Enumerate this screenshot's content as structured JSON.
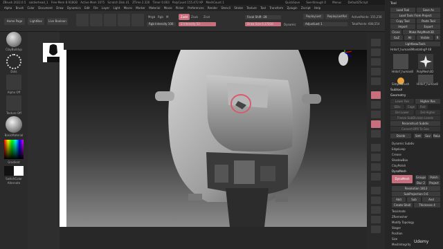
{
  "titlebar": {
    "left": [
      "ZBrush 2022.0.5",
      "soldierhead_1",
      "Free Mem 8.918GB",
      "Active Mem 1075",
      "Scratch Disk 41",
      "ZTime 2.320",
      "Timer 0.003",
      "PolyCount 155.472 KP",
      "MeshCount 1"
    ],
    "right": [
      "QuickSave",
      "See-through 0",
      "Menus",
      "DefaultZScript"
    ]
  },
  "menu": [
    "Alpha",
    "Brush",
    "Color",
    "Document",
    "Draw",
    "Dynamics",
    "Edit",
    "File",
    "Layer",
    "Light",
    "Macro",
    "Marker",
    "Material",
    "Movie",
    "Picker",
    "Preferences",
    "Render",
    "Stencil",
    "Stroke",
    "Texture",
    "Tool",
    "Transform",
    "Zplugin",
    "Zscript",
    "Help"
  ],
  "toolbar": {
    "home_page": "Home Page",
    "lightbox": "LightBox",
    "live_boolean": "Live Boolean",
    "mrgb": "Mrgb",
    "rgb": "Rgb",
    "m": "M",
    "zadd": "Zadd",
    "zsub": "Zsub",
    "zcut": "Zcut",
    "rgb_intensity": "Rgb Intensity 100",
    "z_intensity": "Z Intensity 50",
    "focal_shift": "Focal Shift -28",
    "draw_size": "Draw Size 6.37838",
    "dynamic": "Dynamic",
    "replay_last": "ReplayLast",
    "replay_last_rel": "ReplayLastRel",
    "active_points": "ActivePoints: 155,256",
    "total_points": "TotalPoints: 608,554",
    "adjust_last": "AdjustLast 1"
  },
  "left_shelf": {
    "brush_label": "ClayBuildup",
    "stroke_label": "Dots",
    "alpha_label": "Alpha Off",
    "texture_label": "Texture Off",
    "material_label": "BasicMaterial",
    "gradient_label": "Gradient",
    "switch_color": "SwitchColor",
    "alternate": "Alternate"
  },
  "right_shelf": [
    "Bpr",
    "SPix 3",
    "Persp",
    "Floor",
    "Local",
    "L.Sym",
    "Frame",
    "Move",
    "Scale",
    "Rotate",
    "Line Fill",
    "Transp",
    "Ghost",
    "Solo",
    "Xpose"
  ],
  "tool_panel": {
    "title": "Tool",
    "load_tool": "Load Tool",
    "save_as": "Save As",
    "load_from_project": "Load Tools From Project",
    "copy_tool": "Copy Tool",
    "paste_tool": "Paste Tool",
    "import": "Import",
    "export": "Export",
    "clone": "Clone",
    "make_polymesh": "Make PolyMesh3D",
    "goz": "GoZ",
    "all": "All",
    "visible": "Visible",
    "r": "R",
    "lightbox_tools": "Lightbox▸Tools",
    "current_tool": "Hrdsrf_human8ManbldngP 48",
    "thumbs": [
      "Hrdsrf_human8",
      "PolyMesh3D",
      "SimpleBrush",
      "Hrdsrf_human8"
    ],
    "subtool": "Subtool",
    "geometry": "Geometry",
    "lower_res": "Lower Res",
    "higher_res": "Higher Res",
    "sdiv": "SDiv",
    "cage": "Cage",
    "rstr": "Rstr",
    "del_lower": "Del Lower",
    "del_higher": "Del Higher",
    "freeze_subdiv": "Freeze SubDivision Levels",
    "reconstruct_subdiv": "Reconstruct Subdiv",
    "convert_bpr": "Convert BPR To Geo",
    "divide": "Divide",
    "smt": "Smt",
    "suv": "Suv",
    "relax": "ReLax",
    "dynamic_subdiv": "Dynamic Subdiv",
    "edgeloop": "EdgeLoop",
    "crease": "Crease",
    "shadowbox": "ShadowBox",
    "claypolish": "ClayPolish",
    "dynamesh_section": "DynaMesh",
    "dynamesh_btn": "DynaMesh",
    "groups": "Groups",
    "polish": "Polish",
    "blur": "Blur 2",
    "project": "Project",
    "resolution": "Resolution 1813",
    "subprojection": "SubProjection 0.6",
    "add": "Add",
    "sub": "Sub",
    "and": "And",
    "create_shell": "Create Shell",
    "thickness": "Thickness 4",
    "tessimate": "Tessimate",
    "zremesher": "ZRemesher",
    "modify_topology": "Modify Topology",
    "stager": "Stager",
    "position": "Position",
    "size": "Size",
    "meshintegrity": "MeshIntegrity"
  },
  "watermark": "Udemy",
  "colors": {
    "accent": "#c86f7e",
    "panel": "#2e2e2e",
    "canvas_top": "#0d0d0d",
    "canvas_bottom": "#8a8a8a"
  }
}
